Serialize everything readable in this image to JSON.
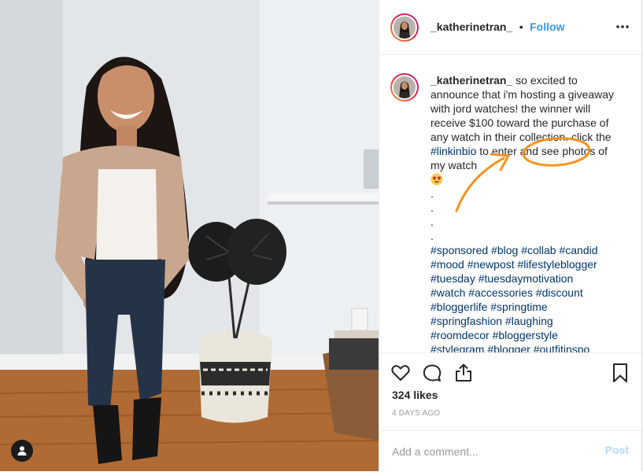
{
  "header": {
    "username": "_katherinetran_",
    "separator": "•",
    "follow_label": "Follow",
    "more_icon": "more-horizontal-icon"
  },
  "caption": {
    "username": "_katherinetran_",
    "text_before": " so excited to announce that i'm hosting a giveaway with jord watches! the winner will receive $100 toward the purchase of any watch in their collection. click the ",
    "link_hashtag": "#linkinbio",
    "text_after": " to enter and see photos of my watch",
    "emoji": "heart-eyes-emoji",
    "dots": [
      ".",
      ".",
      ".",
      "."
    ],
    "hashtags": [
      "#sponsored #blog #collab #candid",
      "#mood #newpost #lifestyleblogger",
      "#tuesday #tuesdaymotivation",
      "#watch #accessories #discount",
      "#bloggerlife #springtime",
      "#springfashion #laughing",
      "#roomdecor #bloggerstyle",
      "#stylegram #blogger #outfitinspo"
    ]
  },
  "actions": {
    "like_icon": "heart-icon",
    "comment_icon": "comment-icon",
    "share_icon": "share-icon",
    "save_icon": "bookmark-icon"
  },
  "likes": "324 likes",
  "timestamp": "4 DAYS AGO",
  "comment": {
    "placeholder": "Add a comment...",
    "post_label": "Post"
  },
  "photo": {
    "user_tag_icon": "user-tag-icon"
  },
  "annotation": {
    "color": "#f7931e"
  }
}
